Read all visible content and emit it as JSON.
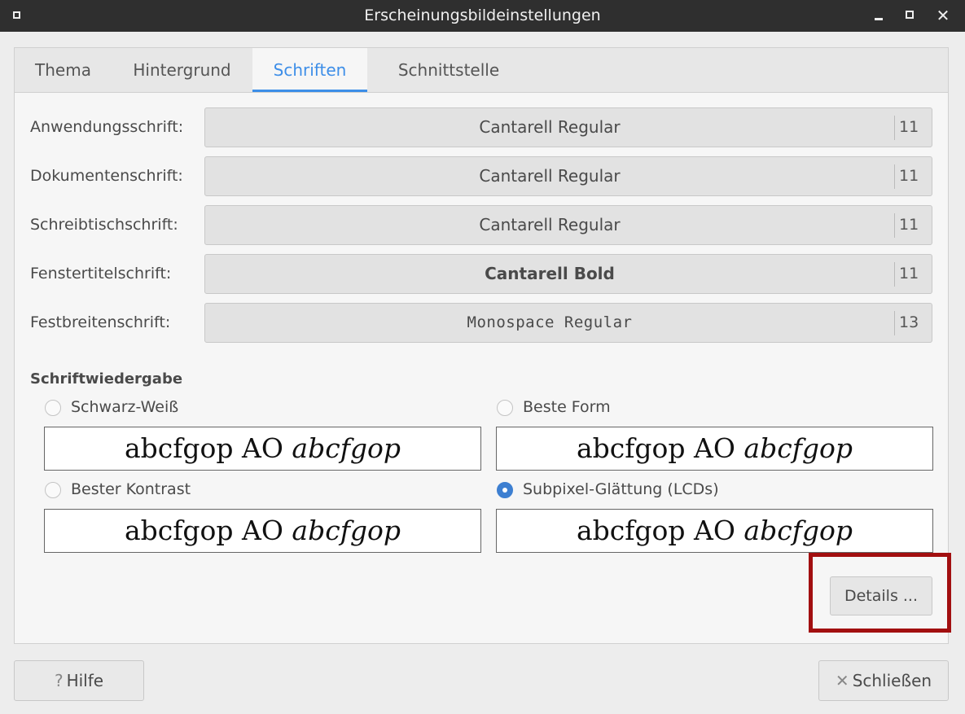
{
  "window": {
    "title": "Erscheinungsbildeinstellungen",
    "menu_icon": "window-menu-icon",
    "minimize_icon": "minimize-icon",
    "maximize_icon": "maximize-icon",
    "close_glyph": "✕"
  },
  "tabs": [
    {
      "label": "Thema",
      "active": false
    },
    {
      "label": "Hintergrund",
      "active": false
    },
    {
      "label": "Schriften",
      "active": true
    },
    {
      "label": "Schnittstelle",
      "active": false
    }
  ],
  "fonts": [
    {
      "label": "Anwendungsschrift:",
      "font": "Cantarell Regular",
      "size": "11"
    },
    {
      "label": "Dokumentenschrift:",
      "font": "Cantarell Regular",
      "size": "11"
    },
    {
      "label": "Schreibtischschrift:",
      "font": "Cantarell Regular",
      "size": "11"
    },
    {
      "label": "Fenstertitelschrift:",
      "font": "Cantarell Bold",
      "size": "11"
    },
    {
      "label": "Festbreitenschrift:",
      "font": "Monospace Regular",
      "size": "13"
    }
  ],
  "rendering": {
    "heading": "Schriftwiedergabe",
    "preview_plain": "abcfgop AO ",
    "preview_italic": "abcfgop",
    "options": [
      {
        "label": "Schwarz-Weiß",
        "checked": false
      },
      {
        "label": "Beste Form",
        "checked": false
      },
      {
        "label": "Bester Kontrast",
        "checked": false
      },
      {
        "label": "Subpixel-Glättung (LCDs)",
        "checked": true
      }
    ]
  },
  "details_button": "Details ...",
  "help_button": {
    "icon": "?",
    "label": "Hilfe"
  },
  "close_button": {
    "icon": "✕",
    "label": "Schließen"
  },
  "colors": {
    "accent": "#3d8ee8",
    "highlight": "#a20f10",
    "titlebar": "#2f2f2f"
  }
}
